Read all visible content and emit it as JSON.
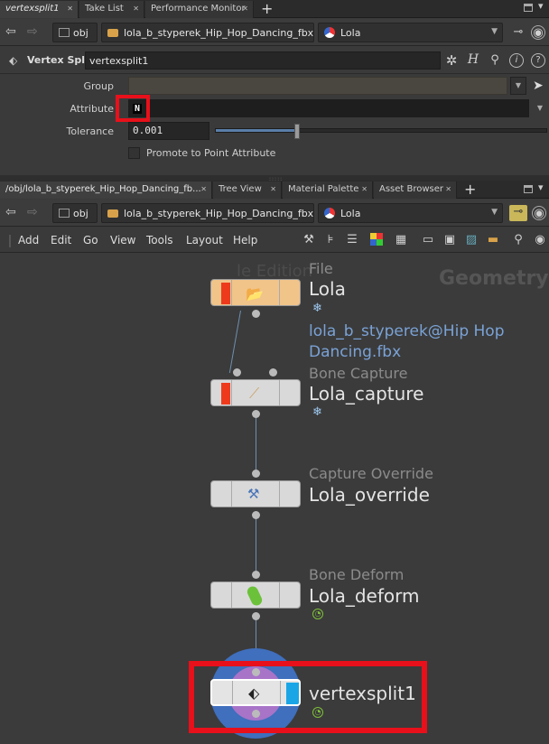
{
  "top_tabs": [
    {
      "label": "vertexsplit1",
      "active": true
    },
    {
      "label": "Take List",
      "active": false
    },
    {
      "label": "Performance Monitor",
      "active": false
    }
  ],
  "path_top": {
    "root": "obj",
    "object": "lola_b_styperek_Hip_Hop_Dancing_fbx",
    "node": "Lola"
  },
  "params": {
    "node_type": "Vertex Split",
    "node_name": "vertexsplit1",
    "group_label": "Group",
    "group_value": "",
    "attribute_label": "Attribute",
    "attribute_value": "N",
    "tolerance_label": "Tolerance",
    "tolerance_value": "0.001",
    "promote_label": "Promote to Point Attribute"
  },
  "bottom_tabs": [
    {
      "label": "/obj/lola_b_styperek_Hip_Hop_Dancing_fb...",
      "active": true
    },
    {
      "label": "Tree View",
      "active": false
    },
    {
      "label": "Material Palette",
      "active": false
    },
    {
      "label": "Asset Browser",
      "active": false
    }
  ],
  "path_bottom": {
    "root": "obj",
    "object": "lola_b_styperek_Hip_Hop_Dancing_fbx",
    "node": "Lola"
  },
  "menu": [
    "Add",
    "Edit",
    "Go",
    "View",
    "Tools",
    "Layout",
    "Help"
  ],
  "network": {
    "context_label": "Geometry",
    "watermark": "le Edition",
    "nodes": [
      {
        "type": "File",
        "name": "Lola",
        "extra": "lola_b_styperek@Hip Hop",
        "extra2": "Dancing.fbx"
      },
      {
        "type": "Bone Capture",
        "name": "Lola_capture"
      },
      {
        "type": "Capture Override",
        "name": "Lola_override"
      },
      {
        "type": "Bone Deform",
        "name": "Lola_deform"
      },
      {
        "type": "",
        "name": "vertexsplit1"
      }
    ]
  },
  "colors": {
    "highlight": "#e8101a",
    "accent_blue": "#1aa6e6",
    "file_stripe": "#ee3a1c",
    "file_bg": "#f1c48a"
  }
}
